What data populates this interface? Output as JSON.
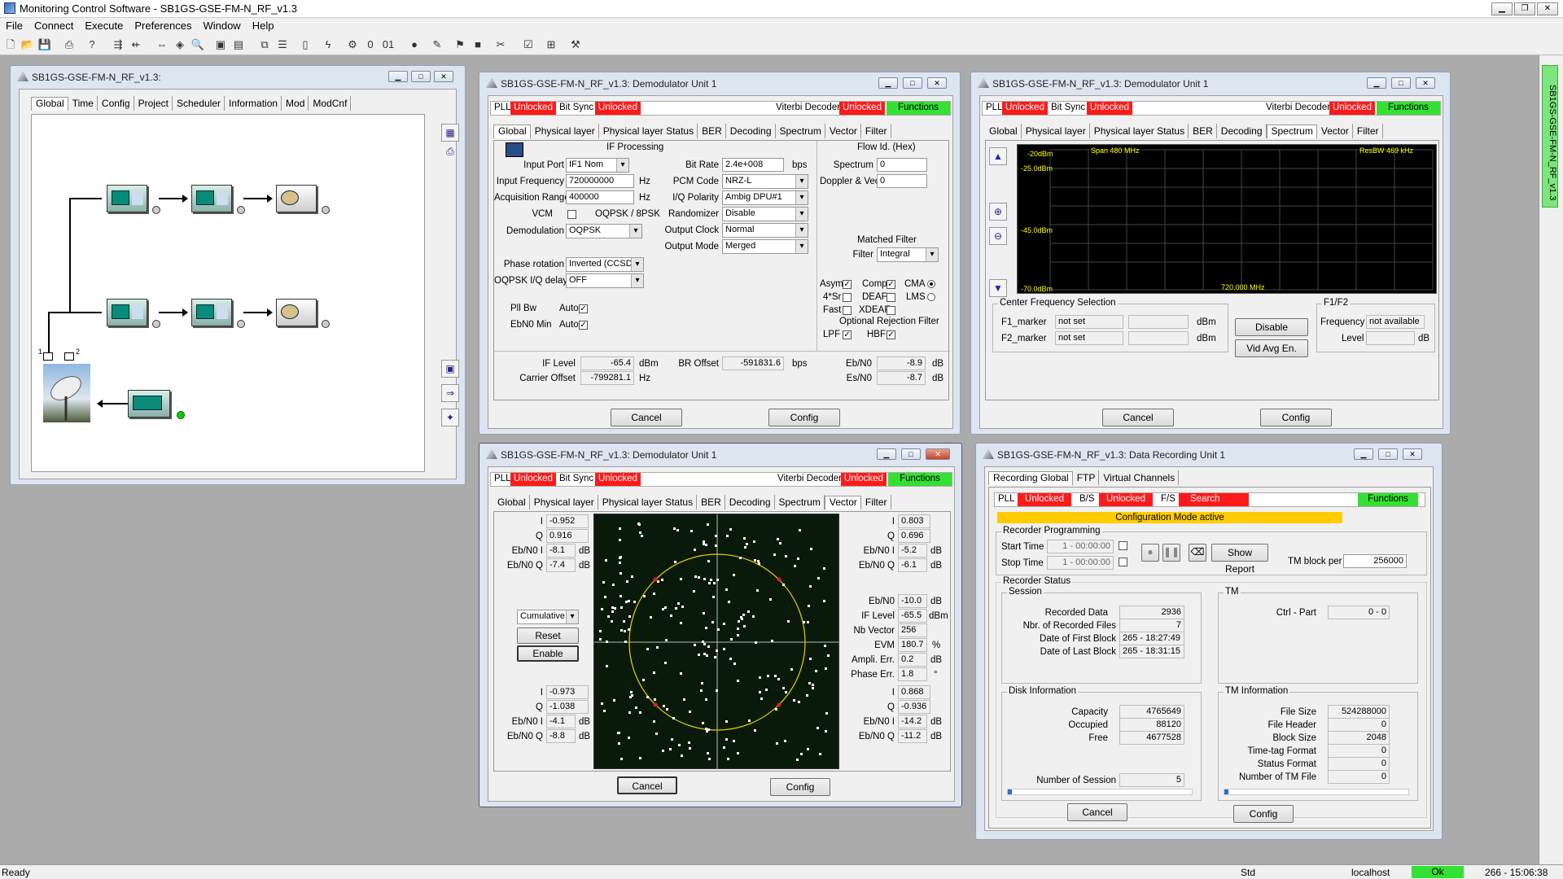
{
  "app": {
    "title": "Monitoring Control Software - SB1GS-GSE-FM-N_RF_v1.3",
    "menu": [
      "File",
      "Connect",
      "Execute",
      "Preferences",
      "Window",
      "Help"
    ],
    "side_tab": "SB1GS-GSE-FM-N_RF_v1.3",
    "status": {
      "left": "Ready",
      "mode": "Std",
      "host": "localhost",
      "ok": "Ok",
      "time": "266 - 15:06:38"
    }
  },
  "win_main": {
    "title": "SB1GS-GSE-FM-N_RF_v1.3:",
    "tabs": [
      "Global",
      "Time",
      "Config",
      "Project",
      "Scheduler",
      "Information",
      "Mod",
      "ModCnf"
    ],
    "port1": "1",
    "port2": "2"
  },
  "demod_common": {
    "pll": "PLL",
    "unlocked": "Unlocked",
    "bitsync": "Bit Sync",
    "viterbi": "Viterbi Decoder",
    "functions": "Functions",
    "tabs": [
      "Global",
      "Physical layer",
      "Physical layer Status",
      "BER",
      "Decoding",
      "Spectrum",
      "Vector",
      "Filter"
    ],
    "cancel": "Cancel",
    "config": "Config"
  },
  "demod1": {
    "title": "SB1GS-GSE-FM-N_RF_v1.3: Demodulator Unit 1",
    "if_processing": "IF Processing",
    "input_port_l": "Input Port",
    "input_port": "IF1 Nom",
    "input_freq_l": "Input Frequency",
    "input_freq": "720000000",
    "hz": "Hz",
    "acq_range_l": "Acquisition Range",
    "acq_range": "400000",
    "vcm_l": "VCM",
    "oqpsk8": "OQPSK / 8PSK",
    "demod_l": "Demodulation",
    "demod": "OQPSK",
    "phase_rot_l": "Phase rotation",
    "phase_rot": "Inverted (CCSD",
    "oqpsk_delay_l": "OQPSK I/Q delay",
    "oqpsk_delay": "OFF",
    "pll_bw_l": "Pll Bw",
    "auto": "Auto",
    "ebn0_min_l": "EbN0 Min",
    "bitrate_l": "Bit Rate",
    "bitrate": "2.4e+008",
    "bps": "bps",
    "pcm_l": "PCM Code",
    "pcm": "NRZ-L",
    "iq_pol_l": "I/Q Polarity",
    "iq_pol": "Ambig DPU#1",
    "rand_l": "Randomizer",
    "rand": "Disable",
    "outclk_l": "Output Clock",
    "outclk": "Normal",
    "outmode_l": "Output Mode",
    "outmode": "Merged",
    "flow_id_l": "Flow Id. (Hex)",
    "spectrum_l": "Spectrum",
    "spectrum_v": "0",
    "doppler_l": "Doppler & Vector",
    "doppler_v": "0",
    "matched_filter": "Matched Filter",
    "filter_l": "Filter",
    "filter_v": "Integral",
    "asym": "Asym",
    "comp": "Comp",
    "cma": "CMA",
    "sr4": "4*Sr",
    "deaf": "DEAF",
    "lms": "LMS",
    "fast": "Fast",
    "xdeaf": "XDEAF",
    "opt_rej": "Optional Rejection Filter",
    "lpf": "LPF",
    "hbf": "HBF",
    "if_level_l": "IF Level",
    "if_level": "-65.4",
    "dbm": "dBm",
    "carrier_off_l": "Carrier Offset",
    "carrier_off": "-799281.1",
    "br_off_l": "BR Offset",
    "br_off": "-591831.6",
    "ebn0_l": "Eb/N0",
    "ebn0": "-8.9",
    "db": "dB",
    "esn0_l": "Es/N0",
    "esn0": "-8.7"
  },
  "demod2": {
    "title": "SB1GS-GSE-FM-N_RF_v1.3: Demodulator Unit 1",
    "ref_top": "-20dBm",
    "span": "Span 480 MHz",
    "resbw": "ResBW 469 kHz",
    "y1": "-25.0dBm",
    "y2": "-45.0dBm",
    "y3": "-70.0dBm",
    "center": "720.000 MHz",
    "cfs": "Center Frequency Selection",
    "f1": "F1_marker",
    "f2": "F2_marker",
    "notset": "not set",
    "dbm": "dBm",
    "disable": "Disable",
    "vidavg": "Vid Avg En.",
    "f1f2": "F1/F2",
    "freq_l": "Frequency",
    "freq": "not available",
    "level_l": "Level",
    "db": "dB"
  },
  "demod3": {
    "title": "SB1GS-GSE-FM-N_RF_v1.3: Demodulator Unit 1",
    "left_top": {
      "i": "-0.952",
      "q": "0.916",
      "ebi": "-8.1",
      "ebq": "-7.4"
    },
    "left_bot": {
      "i": "-0.973",
      "q": "-1.038",
      "ebi": "-4.1",
      "ebq": "-8.8"
    },
    "right_top": {
      "i": "0.803",
      "q": "0.696",
      "ebi": "-5.2",
      "ebq": "-6.1"
    },
    "right_bot": {
      "i": "0.868",
      "q": "-0.936",
      "ebi": "-14.2",
      "ebq": "-11.2"
    },
    "ebn0": "-10.0",
    "iflevel": "-65.5",
    "nbvector": "256",
    "evm": "180.7",
    "ampli": "0.2",
    "phase": "1.8",
    "l_i": "I",
    "l_q": "Q",
    "l_ebi": "Eb/N0 I",
    "l_ebq": "Eb/N0 Q",
    "l_ebn0": "Eb/N0",
    "l_if": "IF Level",
    "l_nb": "Nb Vector",
    "l_evm": "EVM",
    "l_amp": "Ampli. Err.",
    "l_ph": "Phase Err.",
    "db": "dB",
    "dbm": "dBm",
    "pct": "%",
    "deg": "°",
    "mode": "Cumulative",
    "reset": "Reset",
    "enable": "Enable"
  },
  "rec": {
    "title": "SB1GS-GSE-FM-N_RF_v1.3: Data Recording Unit 1",
    "tabs": [
      "Recording Global",
      "FTP",
      "Virtual Channels"
    ],
    "pll": "PLL",
    "unlocked": "Unlocked",
    "bs": "B/S",
    "fs": "F/S",
    "search": "Search",
    "functions": "Functions",
    "cfg_mode": "Configuration Mode active",
    "rec_prog": "Recorder Programming",
    "start_l": "Start Time",
    "stop_l": "Stop Time",
    "time_v": "1 - 00:00:00",
    "show_report": "Show Report",
    "tm_block_l": "TM block per",
    "tm_block": "256000",
    "rec_status": "Recorder Status",
    "session": "Session",
    "tm": "TM",
    "recorded_l": "Recorded Data",
    "recorded": "2936",
    "nfiles_l": "Nbr. of Recorded  Files",
    "nfiles": "7",
    "first_l": "Date of First Block",
    "first": "265 - 18:27:49",
    "last_l": "Date of Last Block",
    "last": "265 - 18:31:15",
    "ctrl_l": "Ctrl - Part",
    "ctrl": "0 - 0",
    "disk": "Disk Information",
    "cap_l": "Capacity",
    "cap": "4765649",
    "occ_l": "Occupied",
    "occ": "88120",
    "free_l": "Free",
    "free": "4677528",
    "nsess_l": "Number of Session",
    "nsess": "5",
    "tminfo": "TM Information",
    "fsize_l": "File Size",
    "fsize": "524288000",
    "fhdr_l": "File Header",
    "fhdr": "0",
    "bsize_l": "Block Size",
    "bsize": "2048",
    "ttf_l": "Time-tag Format",
    "ttf": "0",
    "sf_l": "Status Format",
    "sf": "0",
    "ntm_l": "Number of TM File",
    "ntm": "0",
    "cancel": "Cancel",
    "config": "Config"
  },
  "colors": {
    "red": "#ff1a1a",
    "green": "#33e033",
    "yellow": "#ffcc00",
    "scope_bg": "#0a1a0a",
    "spectrum_bg": "#000000",
    "circle": "#e6d200"
  }
}
